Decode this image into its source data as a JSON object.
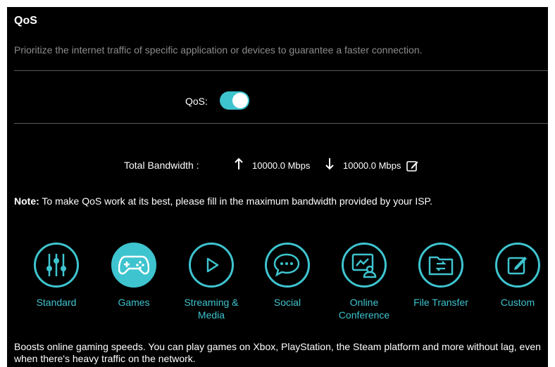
{
  "header": {
    "title": "QoS",
    "subtitle": "Prioritize the internet traffic of specific application or devices to guarantee a faster connection."
  },
  "qos_toggle": {
    "label": "QoS:",
    "enabled": true
  },
  "bandwidth": {
    "label": "Total Bandwidth :",
    "upload": "10000.0 Mbps",
    "download": "10000.0 Mbps"
  },
  "note": {
    "prefix": "Note:",
    "text": " To make QoS work at its best, please fill in the maximum bandwidth provided by your ISP."
  },
  "modes": [
    {
      "label": "Standard",
      "icon": "sliders-icon",
      "active": false
    },
    {
      "label": "Games",
      "icon": "gamepad-icon",
      "active": true
    },
    {
      "label": "Streaming & Media",
      "icon": "play-icon",
      "active": false
    },
    {
      "label": "Social",
      "icon": "chat-bubbles-icon",
      "active": false
    },
    {
      "label": "Online Conference",
      "icon": "conference-icon",
      "active": false
    },
    {
      "label": "File Transfer",
      "icon": "folder-transfer-icon",
      "active": false
    },
    {
      "label": "Custom",
      "icon": "edit-icon",
      "active": false
    }
  ],
  "description": "Boosts online gaming speeds. You can play games on Xbox, PlayStation, the Steam platform and more without lag, even when there's heavy traffic on the network.",
  "colors": {
    "accent": "#3ec4cf",
    "background": "#000000",
    "muted_text": "#8c8c8c"
  }
}
